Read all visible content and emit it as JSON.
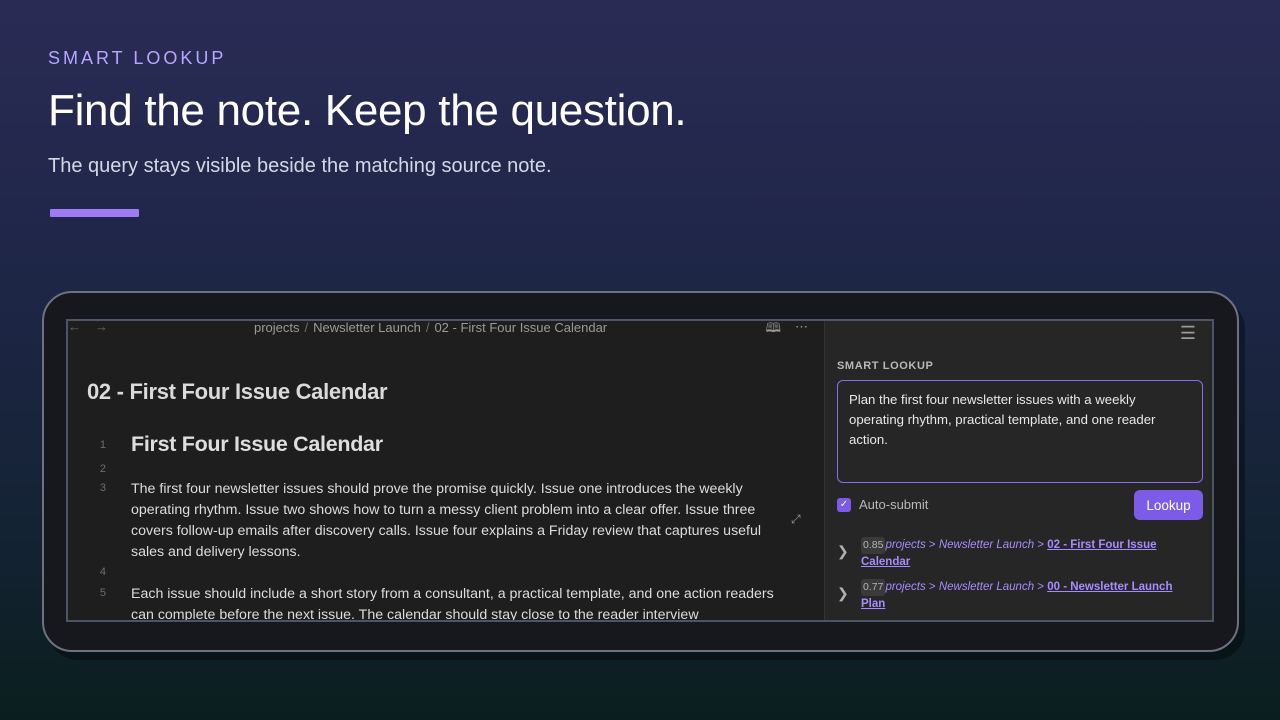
{
  "hero": {
    "kicker": "SMART LOOKUP",
    "title": "Find the note. Keep the question.",
    "subtitle": "The query stays visible beside the matching source note."
  },
  "editor": {
    "breadcrumb": [
      "projects",
      "Newsletter Launch",
      "02 - First Four Issue Calendar"
    ],
    "note_title": "02 - First Four Issue Calendar",
    "lines": [
      {
        "num": "1",
        "text": "First Four Issue Calendar",
        "heading": true
      },
      {
        "num": "2",
        "text": ""
      },
      {
        "num": "3",
        "text": "The first four newsletter issues should prove the promise quickly. Issue one introduces the weekly operating rhythm. Issue two shows how to turn a messy client problem into a clear offer. Issue three covers follow-up emails after discovery calls. Issue four explains a Friday review that captures useful sales and delivery lessons."
      },
      {
        "num": "4",
        "text": ""
      },
      {
        "num": "5",
        "text": "Each issue should include a short story from a consultant, a practical template, and one action readers can complete before the next issue. The calendar should stay close to the reader interview"
      }
    ]
  },
  "panel": {
    "label": "SMART LOOKUP",
    "query_value": "Plan the first four newsletter issues with a weekly operating rhythm, practical template, and one reader action.",
    "auto_submit_label": "Auto-submit",
    "auto_submit_checked": true,
    "lookup_button": "Lookup",
    "results": [
      {
        "score": "0.85",
        "path": [
          "projects",
          "Newsletter Launch"
        ],
        "title": "02 - First Four Issue Calendar"
      },
      {
        "score": "0.77",
        "path": [
          "projects",
          "Newsletter Launch"
        ],
        "title": "00 - Newsletter Launch Plan"
      }
    ]
  },
  "colors": {
    "accent": "#7c5ce6",
    "link": "#a98bff",
    "hero_bar": "#9d7bf2"
  }
}
